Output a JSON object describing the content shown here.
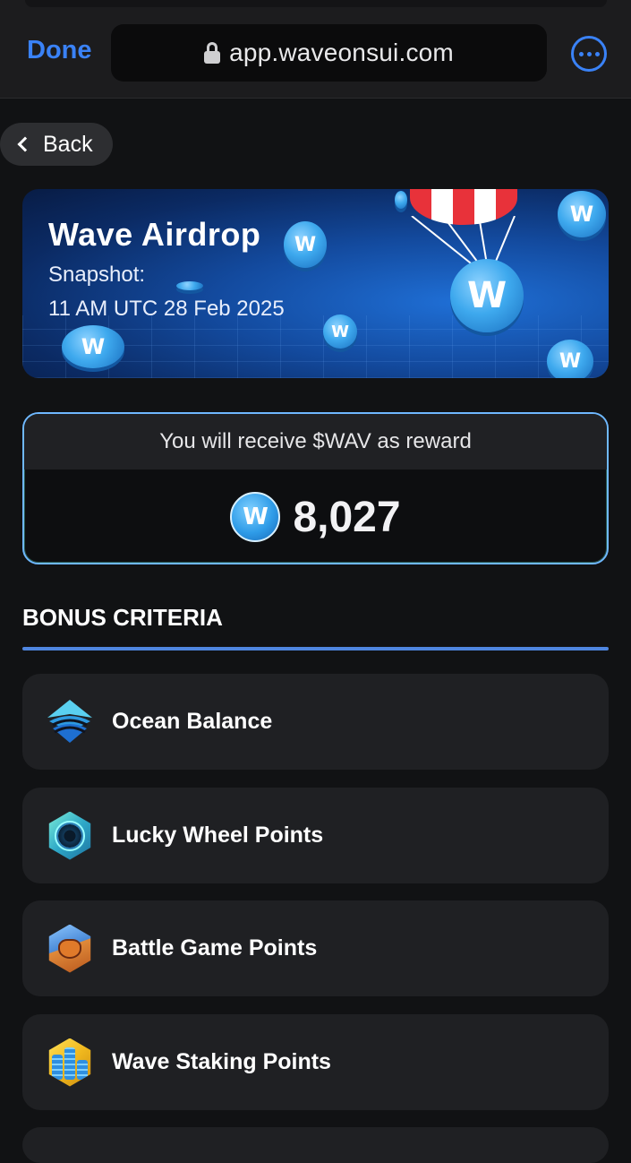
{
  "browser": {
    "done_label": "Done",
    "url": "app.waveonsui.com",
    "lock_icon": "lock-icon",
    "more_icon": "ellipsis-circle-icon",
    "accent_color": "#3a82f7"
  },
  "nav": {
    "back_label": "Back"
  },
  "banner": {
    "title": "Wave Airdrop",
    "snapshot_label": "Snapshot:",
    "snapshot_time": "11 AM UTC 28 Feb 2025"
  },
  "reward": {
    "header": "You will receive $WAV as reward",
    "amount": "8,027",
    "coin_glyph": "W"
  },
  "bonus": {
    "title": "BONUS CRITERIA",
    "items": [
      {
        "label": "Ocean Balance",
        "icon": "ocean-waves-icon"
      },
      {
        "label": "Lucky Wheel Points",
        "icon": "lucky-wheel-icon"
      },
      {
        "label": "Battle Game Points",
        "icon": "battle-game-icon"
      },
      {
        "label": "Wave Staking Points",
        "icon": "staking-coins-icon"
      }
    ]
  }
}
